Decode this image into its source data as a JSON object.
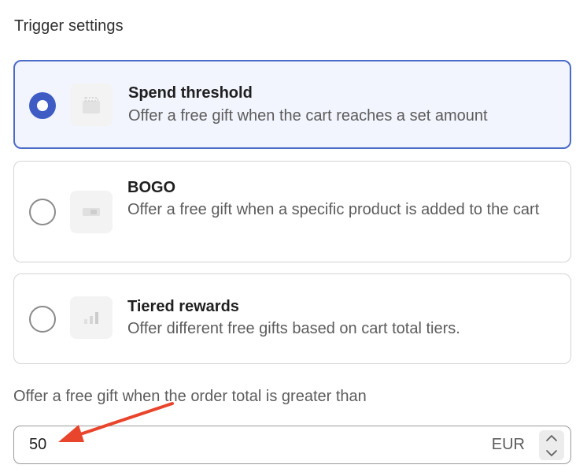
{
  "section": {
    "title": "Trigger settings"
  },
  "options": [
    {
      "title": "Spend threshold",
      "description": "Offer a free gift when the cart reaches a set amount",
      "selected": true,
      "icon": "gift-box-icon"
    },
    {
      "title": "BOGO",
      "description": "Offer a free gift when a specific product is added to the cart",
      "selected": false,
      "icon": "tag-icon"
    },
    {
      "title": "Tiered rewards",
      "description": "Offer different free gifts based on cart total tiers.",
      "selected": false,
      "icon": "bar-chart-icon"
    }
  ],
  "amount": {
    "label": "Offer a free gift when the order total is greater than",
    "value": "50",
    "currency": "EUR"
  },
  "colors": {
    "accent": "#3e5cc4",
    "selected_bg": "#f2f5fe",
    "annotation_arrow": "#e8452c"
  }
}
